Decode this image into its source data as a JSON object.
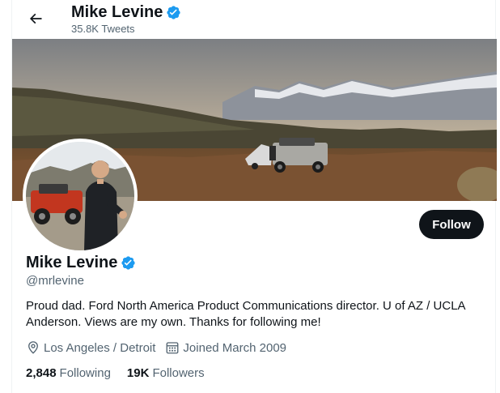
{
  "header": {
    "name": "Mike Levine",
    "tweet_count": "35.8K Tweets"
  },
  "profile": {
    "name": "Mike Levine",
    "handle": "@mrlevine",
    "bio": "Proud dad. Ford North America Product Communications director. U of AZ / UCLA Anderson. Views are my own. Thanks for following me!",
    "location": "Los Angeles / Detroit",
    "joined": "Joined March 2009",
    "following_count": "2,848",
    "following_label": "Following",
    "followers_count": "19K",
    "followers_label": "Followers"
  },
  "actions": {
    "follow_label": "Follow"
  },
  "icons": {
    "back": "arrow-left-icon",
    "verified": "verified-badge-icon",
    "location": "map-pin-icon",
    "calendar": "calendar-icon"
  },
  "colors": {
    "verified_blue": "#1d9bf0",
    "primary_text": "#0f1419",
    "secondary_text": "#536471",
    "follow_button": "#0f1419"
  }
}
